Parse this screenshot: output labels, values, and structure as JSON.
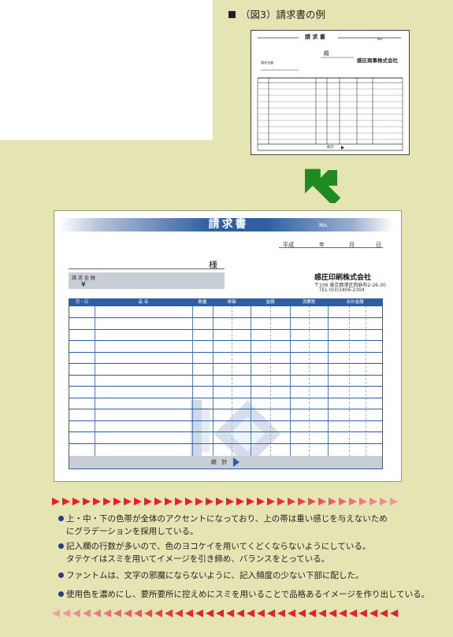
{
  "caption": {
    "marker": "■",
    "text": "（図3）請求書の例"
  },
  "thumbnail": {
    "title": "請 求 書",
    "no": "NO.",
    "sama": "殿",
    "company": "感圧商事株式会社",
    "amount_label": "請求金額",
    "total": "総計"
  },
  "invoice": {
    "title": "請求書",
    "no_label": "No.",
    "date": {
      "era": "平成",
      "year": "年",
      "month": "月",
      "day": "日"
    },
    "sama": "様",
    "amount_label": "請 求 金 額",
    "yen": "¥",
    "company": "感圧印刷株式会社",
    "address": "〒106 東京都港区西麻布2-26-30",
    "tel": "TEL (03)3406-2304",
    "columns": [
      "月・日",
      "品 名",
      "数量",
      "単価",
      "金額",
      "消費税",
      "合計金額"
    ],
    "total_label": "総 計"
  },
  "bullets": [
    {
      "lines": [
        "上・中・下の色帯が全体のアクセントになっており、上の帯は重い感じを与えないため",
        "にグラデーションを採用している。"
      ]
    },
    {
      "lines": [
        "記入欄の行数が多いので、色のヨコケイを用いてくどくならないようにしている。",
        "タテケイはスミを用いてイメージを引き締め、バランスをとっている。"
      ]
    },
    {
      "lines": [
        "ファントムは、文字の邪魔にならないように、記入頻度の少ない下部に配した。"
      ]
    },
    {
      "lines": [
        "使用色を濃めにし、要所要所に控えめにスミを用いることで品格あるイメージを作り出している。"
      ]
    }
  ],
  "colors": {
    "background": "#e5e4b3",
    "band": "#2f5fa0",
    "arrow": "#1f8a1f",
    "triangles_red": "#e8202a",
    "triangles_pink": "#f0a0a8",
    "bullet": "#283c8a"
  }
}
